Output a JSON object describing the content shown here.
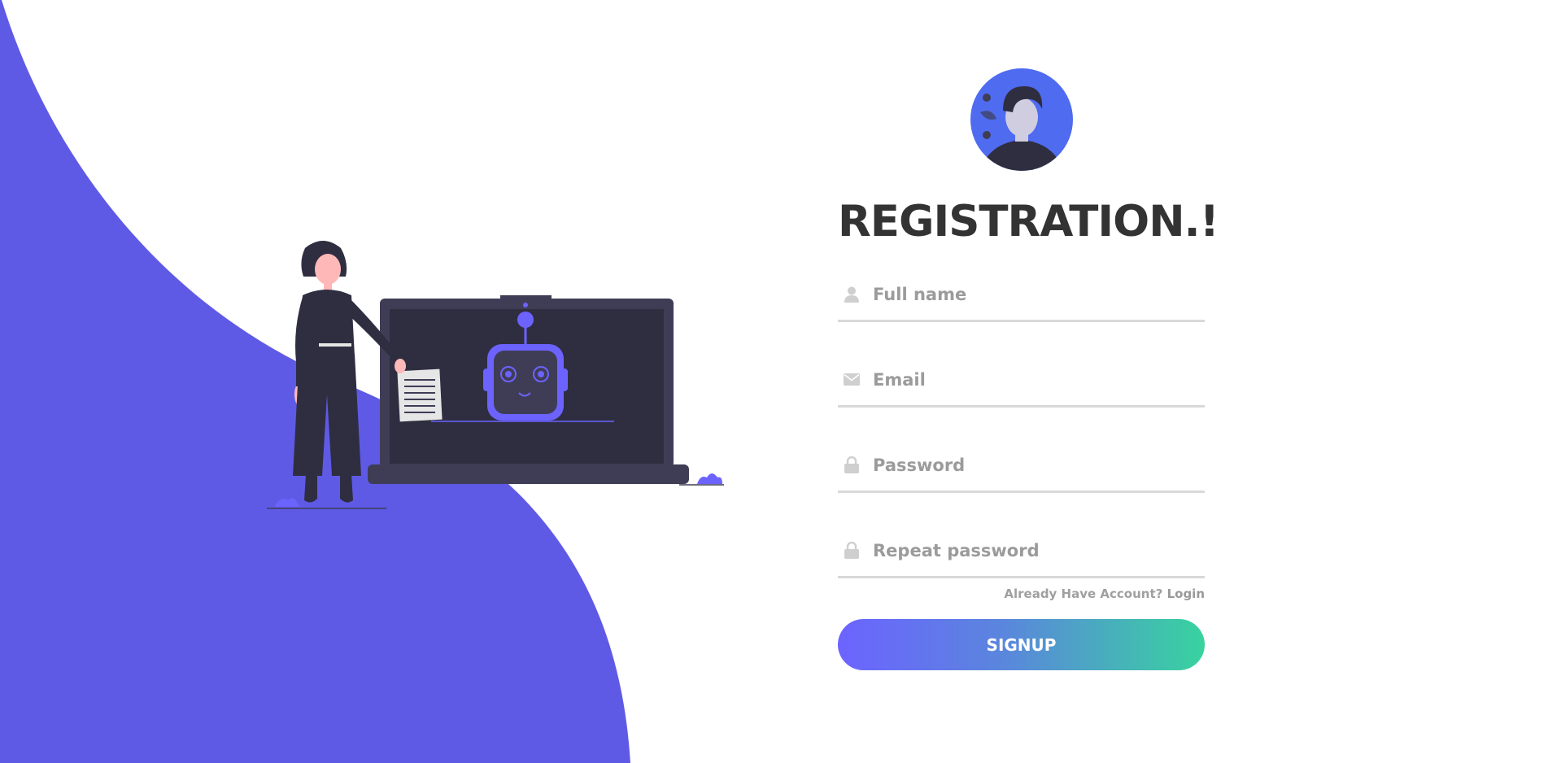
{
  "brand": {
    "accent": "#5f5ae5",
    "gradient_start": "#6c63ff",
    "gradient_end": "#38d39f",
    "title_color": "#333333"
  },
  "form": {
    "title": "REGISTRATION.!",
    "fields": [
      {
        "icon": "user-icon",
        "placeholder": "Full name",
        "type": "text"
      },
      {
        "icon": "envelope-icon",
        "placeholder": "Email",
        "type": "email"
      },
      {
        "icon": "lock-icon",
        "placeholder": "Password",
        "type": "password"
      },
      {
        "icon": "lock-icon",
        "placeholder": "Repeat password",
        "type": "password"
      }
    ],
    "login_prompt": "Already Have Account?",
    "login_link": "Login",
    "submit_label": "SIGNUP"
  }
}
